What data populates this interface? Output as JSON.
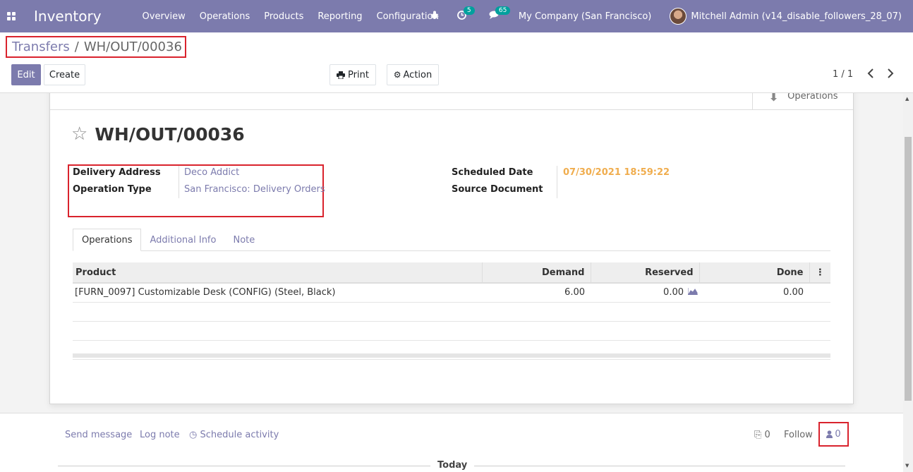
{
  "navbar": {
    "app_name": "Inventory",
    "menu": [
      "Overview",
      "Operations",
      "Products",
      "Reporting",
      "Configuration"
    ],
    "activity_count": "5",
    "message_count": "65",
    "company": "My Company (San Francisco)",
    "user": "Mitchell Admin (v14_disable_followers_28_07)"
  },
  "breadcrumb": {
    "parent": "Transfers",
    "separator": "/",
    "current": "WH/OUT/00036"
  },
  "toolbar": {
    "edit_label": "Edit",
    "create_label": "Create",
    "print_label": "Print",
    "action_label": "Action",
    "pager": "1 / 1"
  },
  "sheet": {
    "smart_button": "Operations",
    "title": "WH/OUT/00036",
    "fields": {
      "delivery_address_label": "Delivery Address",
      "delivery_address": "Deco Addict",
      "operation_type_label": "Operation Type",
      "operation_type": "San Francisco: Delivery Orders",
      "scheduled_date_label": "Scheduled Date",
      "scheduled_date": "07/30/2021 18:59:22",
      "source_document_label": "Source Document",
      "source_document": ""
    },
    "tabs": [
      "Operations",
      "Additional Info",
      "Note"
    ],
    "table": {
      "headers": [
        "Product",
        "Demand",
        "Reserved",
        "Done"
      ],
      "rows": [
        {
          "product": "[FURN_0097] Customizable Desk (CONFIG) (Steel, Black)",
          "demand": "6.00",
          "reserved": "0.00",
          "done": "0.00"
        }
      ]
    }
  },
  "chatter": {
    "send_message": "Send message",
    "log_note": "Log note",
    "schedule_activity": "Schedule activity",
    "attachments": "0",
    "follow": "Follow",
    "followers": "0",
    "today": "Today"
  },
  "colors": {
    "brand": "#7c7bad",
    "highlight": "#d9232d",
    "date": "#f0ad4e"
  }
}
